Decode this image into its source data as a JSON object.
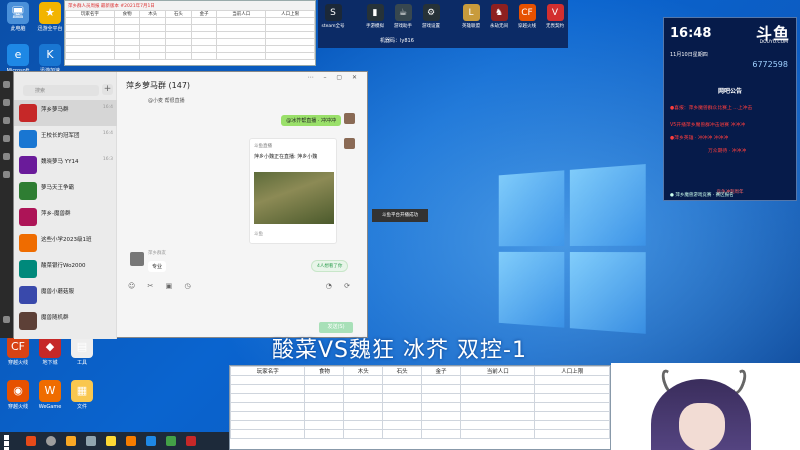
{
  "desktop": {
    "icons": [
      {
        "label": "此电脑",
        "glyph": "🖥",
        "color": "#4a90d9"
      },
      {
        "label": "迅游全平台",
        "glyph": "★",
        "color": "#f2b400"
      },
      {
        "label": "Microsoft Edge",
        "glyph": "e",
        "color": "#1e88e5"
      },
      {
        "label": "迅游加速",
        "glyph": "K",
        "color": "#1976d2"
      },
      {
        "label": "穿越火线",
        "glyph": "CF",
        "color": "#d84315"
      },
      {
        "label": "地下城",
        "glyph": "◆",
        "color": "#c62828"
      },
      {
        "label": "工具",
        "glyph": "▤",
        "color": "#eeeeee"
      },
      {
        "label": "穿越火线",
        "glyph": "◉",
        "color": "#e65100"
      },
      {
        "label": "WeGame",
        "glyph": "W",
        "color": "#ef6c00"
      },
      {
        "label": "文件",
        "glyph": "▦",
        "color": "#f9c74f"
      }
    ]
  },
  "excel_small": {
    "title_bar": "萍乡群人员周报  最新版本 #2021年7月1日",
    "headers": [
      "玩家名字",
      "食物",
      "木头",
      "石头",
      "金子",
      "当前人口",
      "人口上限"
    ]
  },
  "top_strip": {
    "machine_label": "机器码：ly816",
    "icons": [
      {
        "label": "steam全号",
        "glyph": "S",
        "color": "#1b2838"
      },
      {
        "label": "手游模拟",
        "glyph": "▮",
        "color": "#263238"
      },
      {
        "label": "游戏助手",
        "glyph": "☕",
        "color": "#37474f"
      },
      {
        "label": "游戏设置",
        "glyph": "⚙",
        "color": "#263238"
      },
      {
        "label": "英雄联盟",
        "glyph": "L",
        "color": "#c89b3c"
      },
      {
        "label": "永劫无间",
        "glyph": "♞",
        "color": "#8e2020"
      },
      {
        "label": "穿越火线",
        "glyph": "CF",
        "color": "#e65100"
      },
      {
        "label": "无畏契约",
        "glyph": "V",
        "color": "#d32f2f"
      }
    ]
  },
  "right_panel": {
    "clock": "16:48",
    "date": "11月10日星期四",
    "brand": "斗鱼",
    "brand_sub": "DOUYU.COM",
    "count": "6772598",
    "notice_title": "网吧公告",
    "lines": [
      "●喜报：萍乡魔兽群众比赛上 ...上冲击",
      "V5开播萍乡魔兽群冲击进赛  冲冲冲",
      "●萍乡英雄   · 冲冲冲  冲冲冲",
      "万众期待  · 冲冲冲"
    ],
    "mid": "竞争冲刺周年",
    "foot": "● 萍乡魔兽游戏竞赛 · 赛区报名"
  },
  "qq": {
    "search_placeholder": "搜索",
    "chat_title": "萍乡萝马群 (147)",
    "subtitle_tag": "@小麦 帮很直播",
    "conversations": [
      {
        "name": "萍乡萝马群",
        "sub": "",
        "time": "16:4",
        "color": "#c62828"
      },
      {
        "name": "王校长的冠军团",
        "sub": "",
        "time": "16:4",
        "color": "#1976d2"
      },
      {
        "name": "魏晓萝马 YY14",
        "sub": "",
        "time": "16:3",
        "color": "#6a1b9a"
      },
      {
        "name": "萝马天王争霸",
        "sub": "",
        "time": "",
        "color": "#2e7d32"
      },
      {
        "name": "萍乡-魔兽群",
        "sub": "",
        "time": "",
        "color": "#ad1457"
      },
      {
        "name": "这些小学2023级1班",
        "sub": "",
        "time": "",
        "color": "#ef6c00"
      },
      {
        "name": "酸菜银行Wo2000",
        "sub": "",
        "time": "",
        "color": "#00897b"
      },
      {
        "name": "魔兽小蘑菇服",
        "sub": "",
        "time": "",
        "color": "#3949ab"
      },
      {
        "name": "魔兽随机群",
        "sub": "",
        "time": "",
        "color": "#5d4037"
      }
    ],
    "my_message": "@冰芥帮直播 · 冲冲冲",
    "share": {
      "source": "斗鱼直播",
      "title": "萍乡小魏正在直播: 萍乡小魏",
      "from": "斗鱼"
    },
    "other_name": "萍乡群友",
    "other_message": "专业",
    "unread": "4人想看了你",
    "send": "发送(S)",
    "tooltip": "斗鱼平台开播成功"
  },
  "overlay": {
    "match_title": "酸菜VS魏狂 冰芥 双控-1"
  },
  "excel_big": {
    "headers": [
      "玩家名字",
      "食物",
      "木头",
      "石头",
      "金子",
      "当前人口",
      "人口上限"
    ],
    "rows": 7
  }
}
